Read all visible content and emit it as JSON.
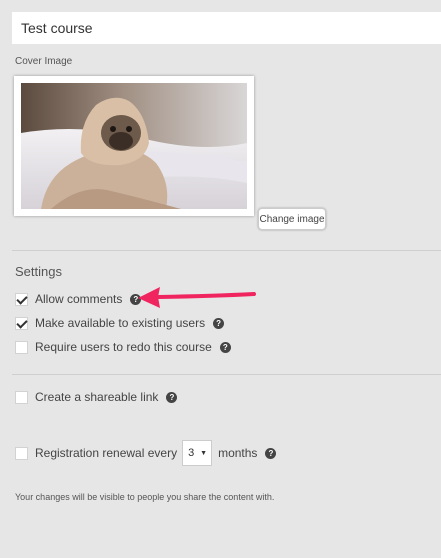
{
  "course": {
    "title_value": "Test course",
    "cover_label": "Cover Image",
    "change_image_label": "Change image"
  },
  "settings": {
    "title": "Settings",
    "options": [
      {
        "label": "Allow comments",
        "checked": true
      },
      {
        "label": "Make available to existing users",
        "checked": true
      },
      {
        "label": "Require users to redo this course",
        "checked": false
      }
    ],
    "shareable_link": {
      "label": "Create a shareable link",
      "checked": false
    },
    "renewal": {
      "label": "Registration renewal every",
      "value": "3",
      "unit": "months",
      "checked": false
    },
    "note": "Your changes will be visible to people you share the content with."
  },
  "colors": {
    "annotation_arrow": "#f0245e",
    "help_icon": "#444444"
  }
}
